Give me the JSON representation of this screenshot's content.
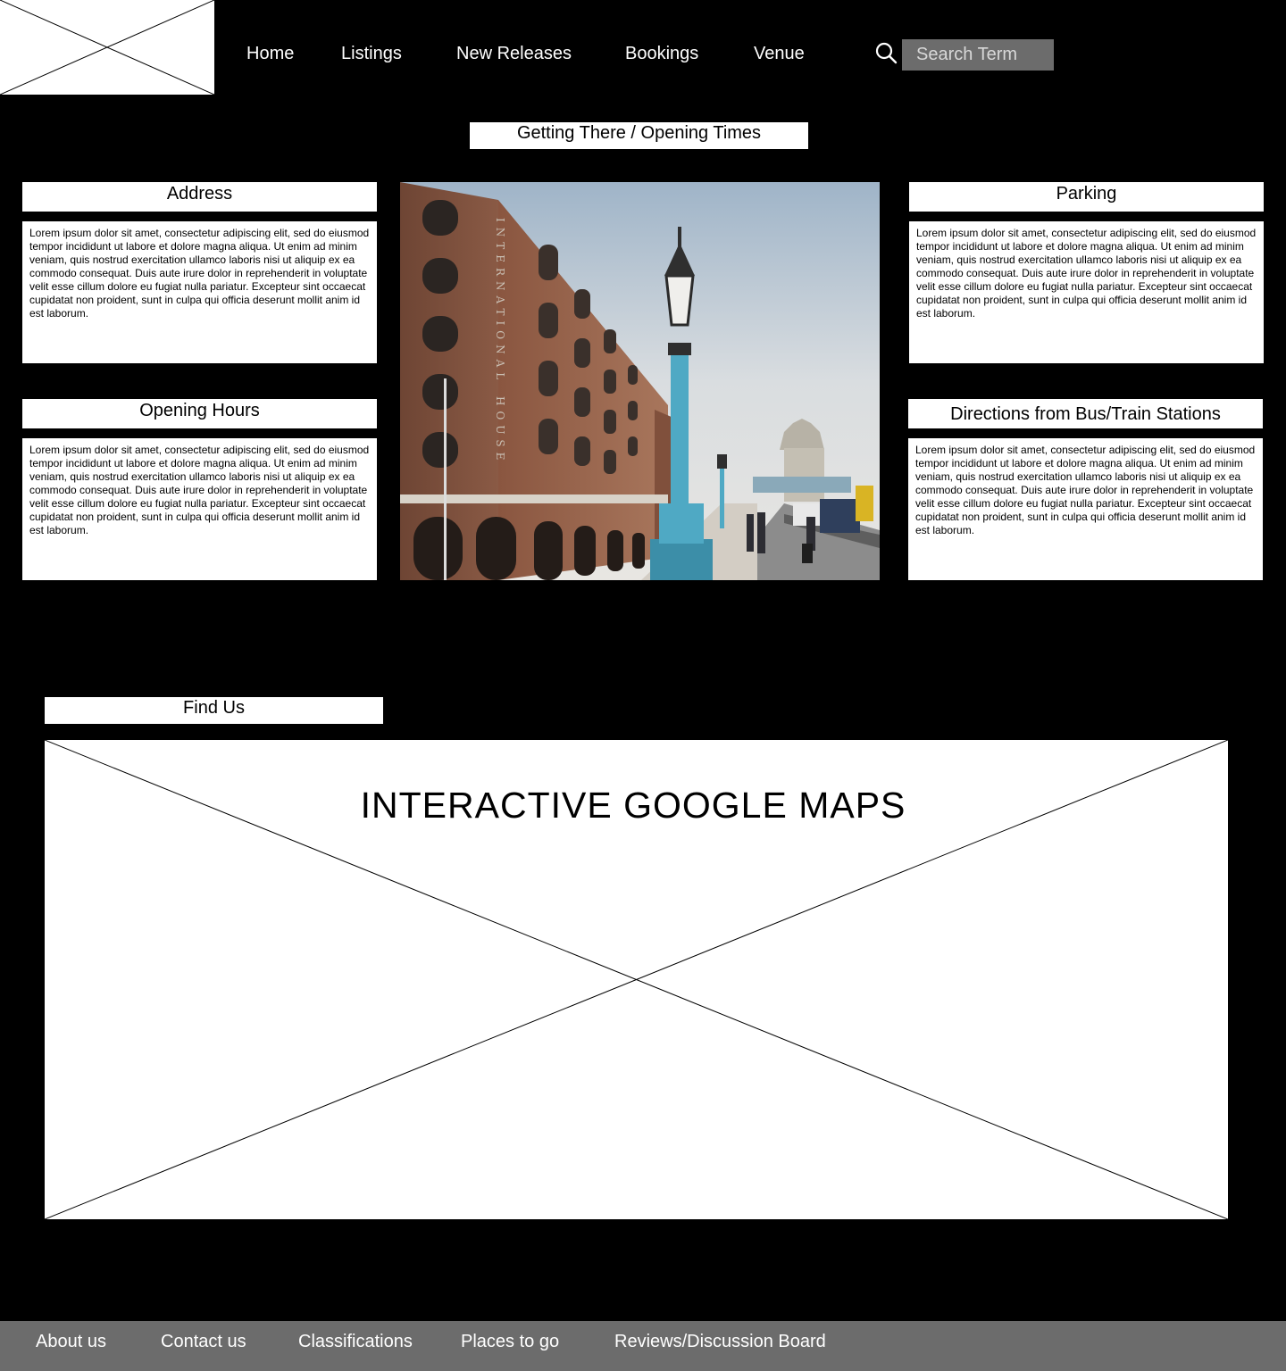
{
  "header": {
    "logo_icon": "placeholder-image-icon",
    "nav": {
      "home": "Home",
      "listings": "Listings",
      "new_releases": "New Releases",
      "bookings": "Bookings",
      "venue": "Venue"
    },
    "search": {
      "icon": "search-icon",
      "placeholder": "Search Term",
      "value": ""
    }
  },
  "main": {
    "page_title": "Getting There / Opening Times",
    "sections": {
      "address": {
        "heading": "Address",
        "body": "Lorem ipsum dolor sit amet, consectetur adipiscing elit, sed do eiusmod tempor incididunt ut labore et dolore magna aliqua. Ut enim ad minim veniam, quis nostrud exercitation ullamco laboris nisi ut aliquip ex ea commodo consequat. Duis aute irure dolor in reprehenderit in voluptate velit esse cillum dolore eu fugiat nulla pariatur. Excepteur sint occaecat cupidatat non proident, sunt in culpa qui officia deserunt mollit anim id est laborum."
      },
      "opening_hours": {
        "heading": "Opening Hours",
        "body": "Lorem ipsum dolor sit amet, consectetur adipiscing elit, sed do eiusmod tempor incididunt ut labore et dolore magna aliqua. Ut enim ad minim veniam, quis nostrud exercitation ullamco laboris nisi ut aliquip ex ea commodo consequat. Duis aute irure dolor in reprehenderit in voluptate velit esse cillum dolore eu fugiat nulla pariatur. Excepteur sint occaecat cupidatat non proident, sunt in culpa qui officia deserunt mollit anim id est laborum."
      },
      "parking": {
        "heading": "Parking",
        "body": "Lorem ipsum dolor sit amet, consectetur adipiscing elit, sed do eiusmod tempor incididunt ut labore et dolore magna aliqua. Ut enim ad minim veniam, quis nostrud exercitation ullamco laboris nisi ut aliquip ex ea commodo consequat. Duis aute irure dolor in reprehenderit in voluptate velit esse cillum dolore eu fugiat nulla pariatur. Excepteur sint occaecat cupidatat non proident, sunt in culpa qui officia deserunt mollit anim id est laborum."
      },
      "directions": {
        "heading": "Directions from Bus/Train Stations",
        "body": "Lorem ipsum dolor sit amet, consectetur adipiscing elit, sed do eiusmod tempor incididunt ut labore et dolore magna aliqua. Ut enim ad minim veniam, quis nostrud exercitation ullamco laboris nisi ut aliquip ex ea commodo consequat. Duis aute irure dolor in reprehenderit in voluptate velit esse cillum dolore eu fugiat nulla pariatur. Excepteur sint occaecat cupidatat non proident, sunt in culpa qui officia deserunt mollit anim id est laborum."
      }
    },
    "photo": {
      "building_lettering": "INTERNATIONAL HOUSE"
    },
    "find_us": {
      "heading": "Find Us",
      "map_label": "INTERACTIVE GOOGLE MAPS"
    }
  },
  "footer": {
    "about": "About us",
    "contact": "Contact us",
    "classifications": "Classifications",
    "places": "Places to go",
    "reviews": "Reviews/Discussion Board"
  },
  "colors": {
    "page_background": "#000000",
    "panel_background": "#ffffff",
    "footer_background": "#6c6c6c",
    "search_background": "#6c6c6c",
    "nav_text": "#ffffff"
  }
}
